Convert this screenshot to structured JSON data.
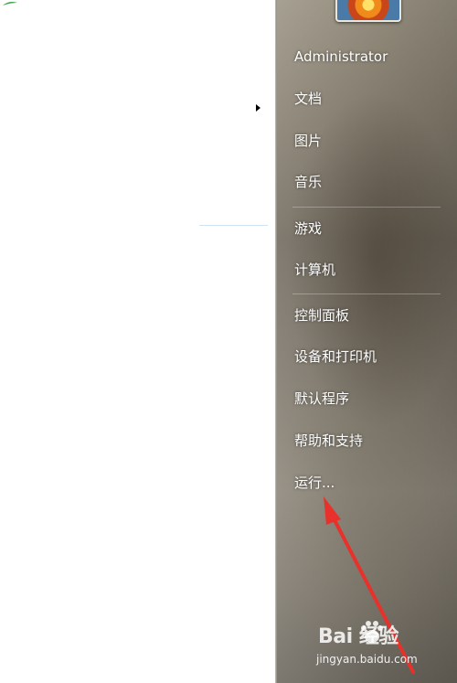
{
  "start_menu": {
    "user_name": "Administrator",
    "items": [
      {
        "label": "文档"
      },
      {
        "label": "图片"
      },
      {
        "label": "音乐"
      },
      {
        "label": "游戏"
      },
      {
        "label": "计算机"
      },
      {
        "label": "控制面板"
      },
      {
        "label": "设备和打印机"
      },
      {
        "label": "默认程序"
      },
      {
        "label": "帮助和支持"
      },
      {
        "label": "运行..."
      }
    ]
  },
  "annotation": {
    "color": "#e8312a",
    "icon": "red-arrow-pointing-to-run"
  },
  "watermark": {
    "logo_text": "Bai 经验",
    "url": "jingyan.baidu.com"
  }
}
